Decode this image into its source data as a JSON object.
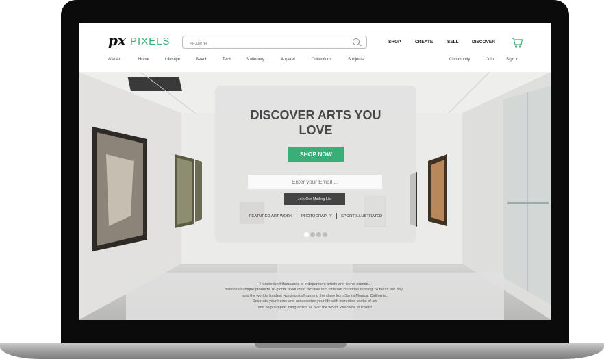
{
  "brand": {
    "mark": "px",
    "name": "PIXELS"
  },
  "search": {
    "placeholder": "SEARCH..."
  },
  "top_nav": [
    "SHOP",
    "CREATE",
    "SELL",
    "DISCOVER"
  ],
  "category_nav": [
    "Wall Art",
    "Home",
    "Lifestlye",
    "Beach",
    "Tech",
    "Stationery",
    "Apparel",
    "Collections",
    "Subjects"
  ],
  "account_nav": [
    "Community",
    "Join",
    "Sign in"
  ],
  "hero": {
    "headline_line1": "DISCOVER ARTS YOU",
    "headline_line2": "LOVE",
    "shop_button": "SHOP NOW",
    "email_placeholder": "Enter your Email ...",
    "join_button": "Join Our Mailing List",
    "links": [
      "FEATURED ART WORK",
      "PHOTOGRAPHY",
      "SPORT ILLUSTRATED"
    ],
    "carousel": {
      "total": 4,
      "active": 1
    }
  },
  "info_lines": [
    "Hundreds of thousands of independent artists and iconic brands..",
    "millions of unique products  16 global production facilities in 5 different countries running 24 hours per day...",
    "and the world's hardest working staff running the show from Santa Monica, California.",
    "Decorate your home and accessorize your life with incredible works of art.",
    "and help support living artists all over the world.   Welcome to Pixels!"
  ],
  "icons": {
    "search": "search-icon",
    "cart": "cart-icon"
  },
  "colors": {
    "accent": "#3aae77",
    "dark_button": "#444444"
  }
}
